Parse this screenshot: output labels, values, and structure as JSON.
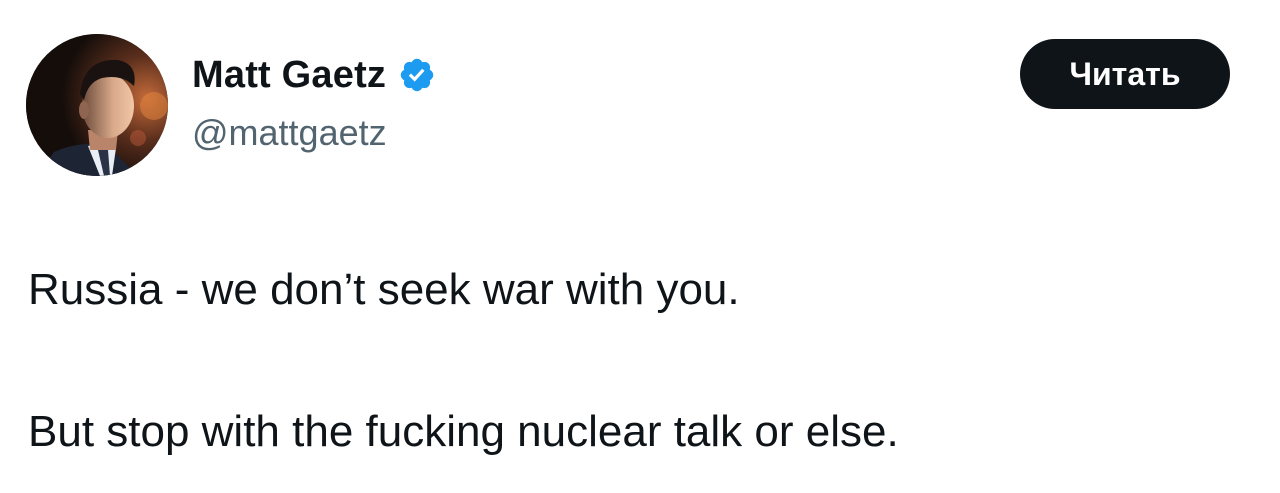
{
  "author": {
    "display_name": "Matt Gaetz",
    "handle": "@mattgaetz",
    "avatar_icon": "profile-photo",
    "verified_icon": "verified-badge-icon",
    "verified_color": "#1d9bf0"
  },
  "actions": {
    "read_label": "Читать"
  },
  "tweet": {
    "lines": [
      "Russia - we don’t seek war with you.",
      "But stop with the fucking nuclear talk or else."
    ]
  },
  "colors": {
    "text": "#0f1419",
    "secondary_text": "#536471",
    "button_bg": "#0f1419",
    "button_text": "#ffffff"
  }
}
